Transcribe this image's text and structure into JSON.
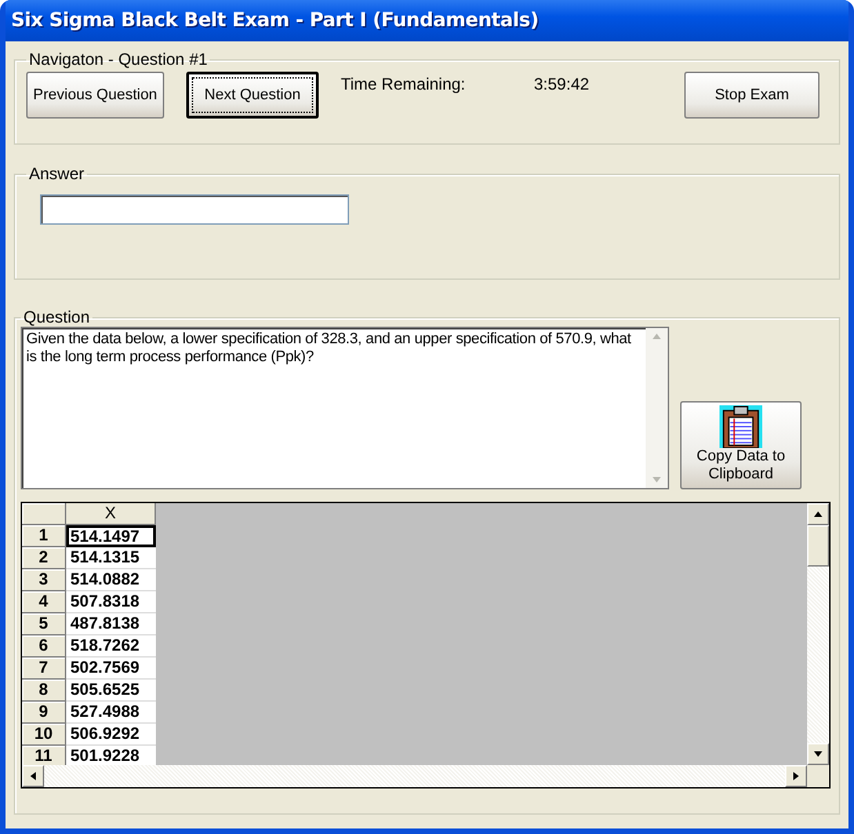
{
  "window": {
    "title": "Six Sigma Black Belt Exam - Part I (Fundamentals)"
  },
  "navigation": {
    "legend": "Navigaton - Question #1",
    "buttons": [
      {
        "label": "Previous Question",
        "focused": false
      },
      {
        "label": "Next Question",
        "focused": true
      }
    ],
    "time_label": "Time Remaining:",
    "time_value": "3:59:42",
    "stop_button": {
      "label": "Stop Exam",
      "focused": false
    }
  },
  "answer": {
    "legend": "Answer"
  },
  "question": {
    "legend": "Question",
    "text": "Given the data below, a lower specification of 328.3, and an upper specification of 570.9, what is the long term process performance (Ppk)?",
    "copy_button": "Copy Data to Clipboard"
  },
  "table": {
    "columns": [
      "X"
    ],
    "rows": [
      {
        "index": "1",
        "value": "514.1497",
        "selected": true
      },
      {
        "index": "2",
        "value": "514.1315",
        "selected": false
      },
      {
        "index": "3",
        "value": "514.0882",
        "selected": false
      },
      {
        "index": "4",
        "value": "507.8318",
        "selected": false
      },
      {
        "index": "5",
        "value": "487.8138",
        "selected": false
      },
      {
        "index": "6",
        "value": "518.7262",
        "selected": false
      },
      {
        "index": "7",
        "value": "502.7569",
        "selected": false
      },
      {
        "index": "8",
        "value": "505.6525",
        "selected": false
      },
      {
        "index": "9",
        "value": "527.4988",
        "selected": false
      },
      {
        "index": "10",
        "value": "506.9292",
        "selected": false
      },
      {
        "index": "11",
        "value": "501.9228",
        "selected": false
      }
    ]
  }
}
